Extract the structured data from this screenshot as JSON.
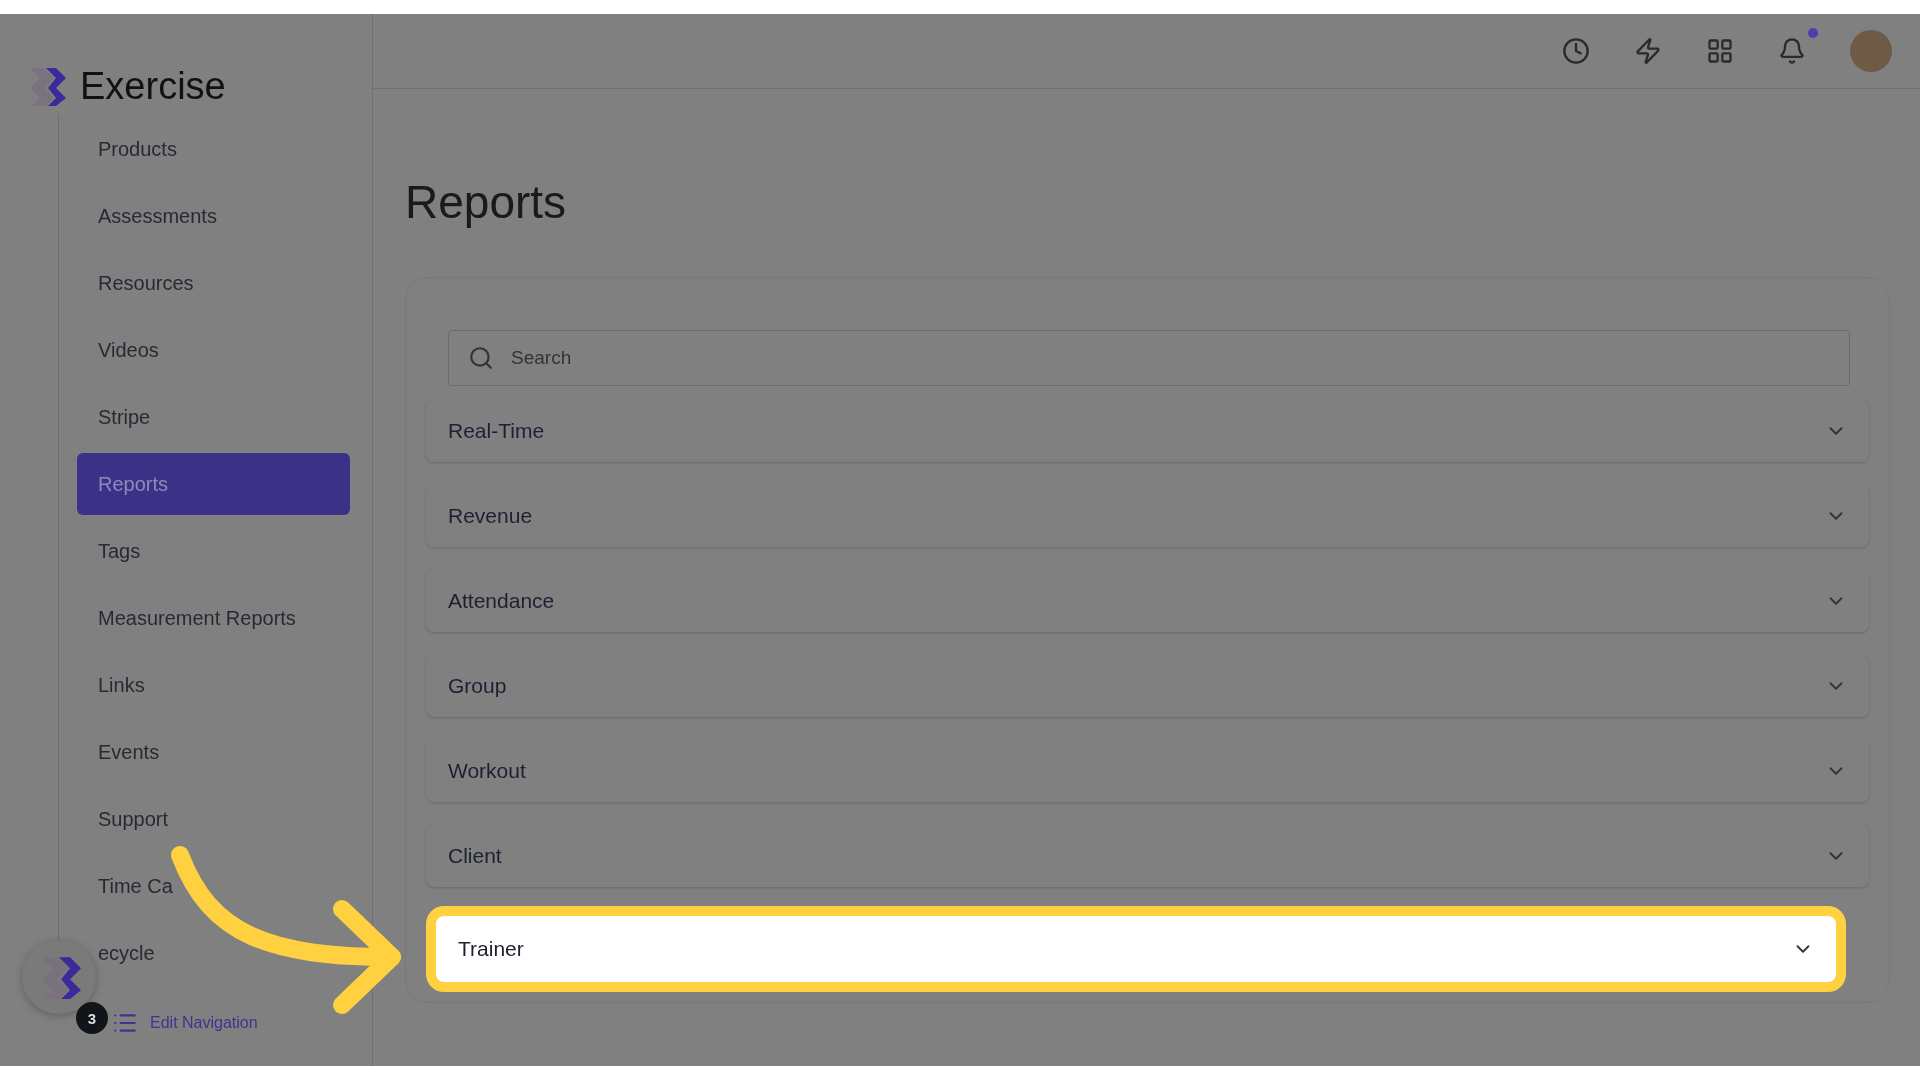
{
  "brand": {
    "name": "Exercise"
  },
  "nav": [
    {
      "label": "Products",
      "selected": false
    },
    {
      "label": "Assessments",
      "selected": false
    },
    {
      "label": "Resources",
      "selected": false
    },
    {
      "label": "Videos",
      "selected": false
    },
    {
      "label": "Stripe",
      "selected": false
    },
    {
      "label": "Reports",
      "selected": true
    },
    {
      "label": "Tags",
      "selected": false
    },
    {
      "label": "Measurement Reports",
      "selected": false
    },
    {
      "label": "Links",
      "selected": false
    },
    {
      "label": "Events",
      "selected": false
    },
    {
      "label": "Support",
      "selected": false
    },
    {
      "label": "Time Ca",
      "selected": false
    },
    {
      "label": "ecycle",
      "selected": false
    }
  ],
  "helper_badge": "3",
  "edit_navigation": "Edit Navigation",
  "topbar": {
    "notification_dot": true
  },
  "page_title": "Reports",
  "search": {
    "placeholder": "Search"
  },
  "sections": [
    {
      "label": "Real-Time",
      "expanded": false,
      "highlighted": false
    },
    {
      "label": "Revenue",
      "expanded": false,
      "highlighted": false
    },
    {
      "label": "Attendance",
      "expanded": false,
      "highlighted": false
    },
    {
      "label": "Group",
      "expanded": false,
      "highlighted": false
    },
    {
      "label": "Workout",
      "expanded": false,
      "highlighted": false
    },
    {
      "label": "Client",
      "expanded": false,
      "highlighted": false
    },
    {
      "label": "Trainer",
      "expanded": false,
      "highlighted": true
    }
  ]
}
